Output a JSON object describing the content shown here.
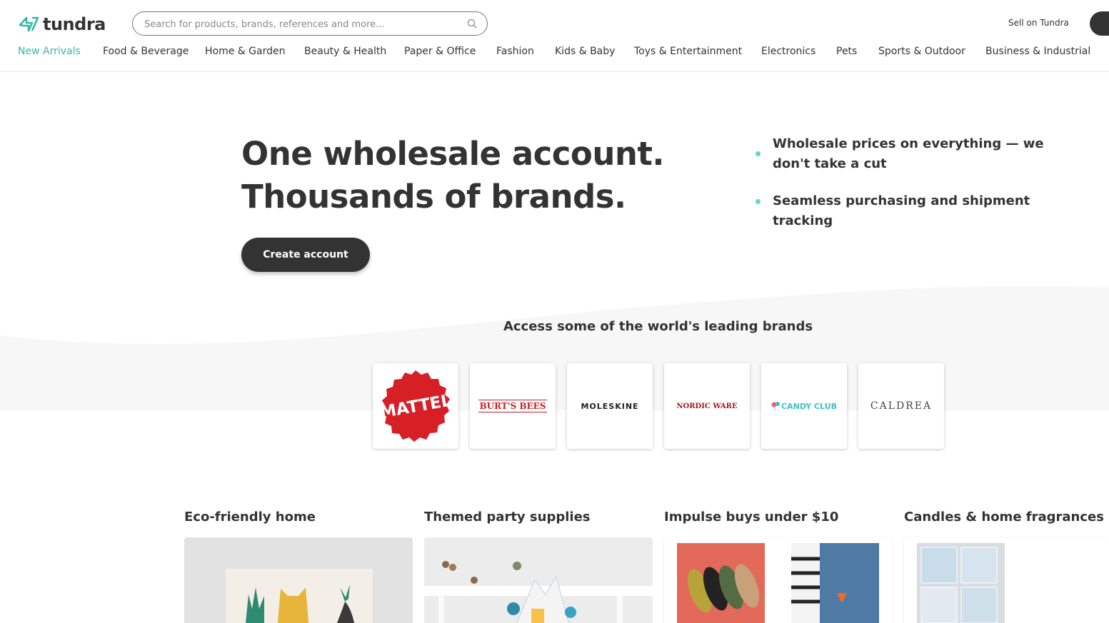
{
  "header": {
    "logo_text": "tundra",
    "search_placeholder": "Search for products, brands, references and more...",
    "sell_link": "Sell on Tundra"
  },
  "nav": {
    "items": [
      {
        "label": "New Arrivals",
        "active": true
      },
      {
        "label": "Food & Beverage"
      },
      {
        "label": "Home & Garden"
      },
      {
        "label": "Beauty & Health"
      },
      {
        "label": "Paper & Office"
      },
      {
        "label": "Fashion"
      },
      {
        "label": "Kids & Baby"
      },
      {
        "label": "Toys & Entertainment"
      },
      {
        "label": "Electronics"
      },
      {
        "label": "Pets"
      },
      {
        "label": "Sports & Outdoor"
      },
      {
        "label": "Business & Industrial"
      }
    ]
  },
  "hero": {
    "title_line1": "One wholesale account.",
    "title_line2": "Thousands of brands.",
    "cta": "Create account",
    "features": [
      "Wholesale prices on everything — we don't take a cut",
      "Seamless purchasing and shipment tracking"
    ]
  },
  "brands": {
    "heading": "Access some of the world's leading brands",
    "items": [
      "MATTEL",
      "BURT'S BEES",
      "MOLESKINE",
      "NORDIC WARE",
      "CANDY CLUB",
      "CALDREA"
    ]
  },
  "categories": [
    {
      "title": "Eco-friendly home"
    },
    {
      "title": "Themed party supplies"
    },
    {
      "title": "Impulse buys under $10"
    },
    {
      "title": "Candles & home fragrances"
    }
  ],
  "colors": {
    "accent": "#3ab5a8",
    "dark": "#333333",
    "mattel_red": "#d71f26"
  }
}
